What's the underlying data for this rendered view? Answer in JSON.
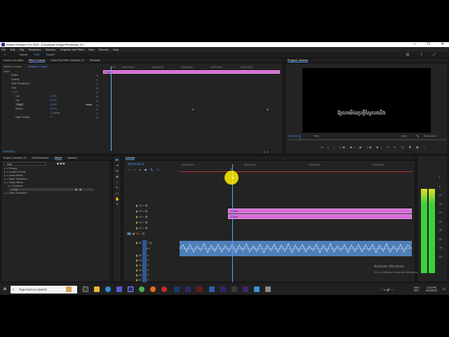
{
  "window": {
    "title": "Adobe Premiere Pro 2023 - D:\\Karaoke Song\\PR\\Karaoke_01 *",
    "controls": {
      "minimize": "—",
      "maximize": "☐",
      "close": "✕"
    }
  },
  "menu": [
    "File",
    "Edit",
    "Clip",
    "Sequence",
    "Markers",
    "Graphics and Titles",
    "View",
    "Window",
    "Help"
  ],
  "workspaces": [
    "Import",
    "Edit",
    "Export"
  ],
  "effect_controls": {
    "tabs": [
      "Source: (no clips)",
      "Effect Controls",
      "Audio Clip Mixer: Karaoke_01",
      "Metadata"
    ],
    "source_path": "Source • 2-3.psd",
    "sequence_path": "Karaoke • 2-3.psd",
    "section_video": "Video",
    "rows": {
      "motion": "Motion",
      "opacity": "Opacity",
      "time_remapping": "Time Remapping",
      "crop": "Crop",
      "left": "Left",
      "left_val": "0.0 %",
      "top": "Top",
      "top_val": "0.0 %",
      "right": "Right",
      "right_val": "6.2 %",
      "bottom": "Bottom",
      "bottom_val": "0.0 %",
      "zoom": "Zoom",
      "edge_feather": "Edge Feather",
      "edge_feather_val": "0"
    },
    "clip_label": "2-3.psd",
    "ruler": [
      "00:00",
      "00:00:02:00",
      "00:00:04:00",
      "00:00:06:00",
      "00:00:08:00",
      "00:00:10:00"
    ],
    "timecode": "00:00:23:11"
  },
  "program": {
    "title": "Program: Karaoke",
    "subtitle": "ឱ្យលាមើលប្រក្ដីស្ដែលឃើង",
    "timecode": "00:00:23:11",
    "fit": "Fit",
    "resolution": "1/2",
    "duration": "00:04:23:12"
  },
  "project": {
    "tabs": [
      "Project: Karaoke_01",
      "Media Browser",
      "Effects",
      "Markers"
    ],
    "search_value": "crop",
    "tree": [
      "Presets",
      "Lumetri Presets",
      "Audio Effects",
      "Audio Transitions",
      "Video Effects",
      "Transform",
      "Crop",
      "Video Transitions"
    ]
  },
  "timeline": {
    "tab": "Karaoke",
    "timecode": "00:00:23:11",
    "ruler": [
      "00:00:00:00",
      "00:00:15:00",
      "00:00:30:00",
      "00:00:45:00",
      "00:01:00:00"
    ],
    "video_tracks": [
      "V6",
      "V5",
      "V4",
      "V3",
      "V2",
      "V1"
    ],
    "audio_tracks": [
      "A1",
      "A2",
      "A3",
      "A4",
      "A5",
      "A6",
      "A7"
    ],
    "audio_label": "Audio 1",
    "clips": [
      "2-3.psd",
      "2-3.psd"
    ]
  },
  "meter": {
    "scale": [
      "0",
      "-6",
      "-12",
      "-18",
      "-24",
      "-30",
      "-36",
      "-42",
      "-48",
      "-54"
    ],
    "left_level": 0.86,
    "right_level": 0.86
  },
  "watermark": {
    "line1": "Activate Windows",
    "line2": "Go to Settings to activate Windows."
  },
  "taskbar": {
    "search_placeholder": "Type here to search",
    "language": "ENG",
    "region": "INTL",
    "time": "2:29 PM",
    "date": "9/12/2023"
  }
}
